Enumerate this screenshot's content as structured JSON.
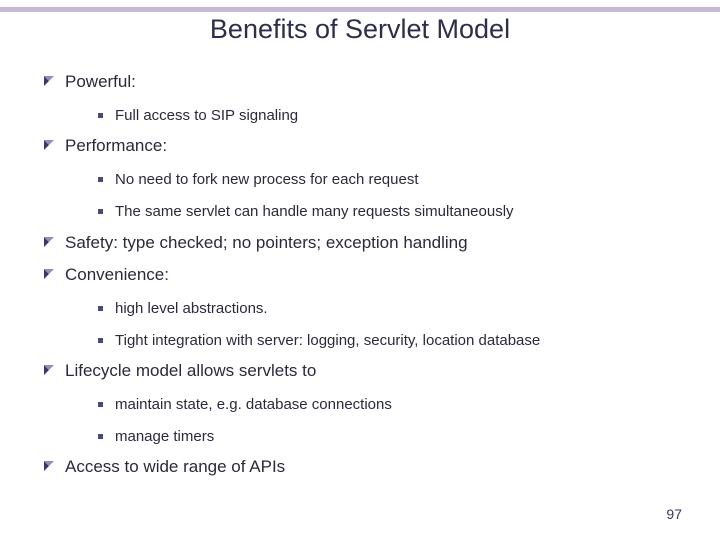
{
  "title": "Benefits of Servlet Model",
  "items": {
    "i0": {
      "text": "Powerful:"
    },
    "i0s0": {
      "text": "Full access to SIP signaling"
    },
    "i1": {
      "text": "Performance:"
    },
    "i1s0": {
      "text": "No need to fork new process for each request"
    },
    "i1s1": {
      "text": "The same servlet can handle many requests simultaneously"
    },
    "i2": {
      "text": "Safety: type checked; no pointers; exception handling"
    },
    "i3": {
      "text": "Convenience:"
    },
    "i3s0": {
      "text": "high level abstractions."
    },
    "i3s1": {
      "text": "Tight integration with server: logging, security, location database"
    },
    "i4": {
      "text": "Lifecycle model allows servlets to"
    },
    "i4s0": {
      "text": "maintain state, e.g. database connections"
    },
    "i4s1": {
      "text": "manage timers"
    },
    "i5": {
      "text": "Access to wide range of APIs"
    }
  },
  "pageNumber": "97"
}
